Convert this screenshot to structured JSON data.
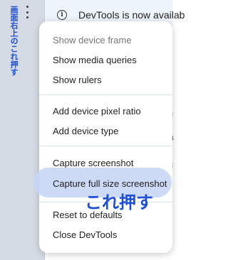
{
  "annotation": {
    "vertical_note": "画面右上のこれ押す",
    "callout": "これ押す"
  },
  "banner": {
    "text": "DevTools is now availab",
    "icon": "info-icon"
  },
  "menu": {
    "items": [
      {
        "label": "Show device frame",
        "disabled": true
      },
      {
        "label": "Show media queries"
      },
      {
        "label": "Show rulers"
      },
      {
        "label": "Add device pixel ratio"
      },
      {
        "label": "Add device type"
      },
      {
        "label": "Capture screenshot"
      },
      {
        "label": "Capture full size screenshot",
        "highlighted": true
      },
      {
        "label": "Reset to defaults"
      },
      {
        "label": "Close DevTools"
      }
    ]
  },
  "colors": {
    "annotation": "#1c4fd6",
    "highlight": "#c6d6f5",
    "left_strip": "#d5dbe4"
  }
}
